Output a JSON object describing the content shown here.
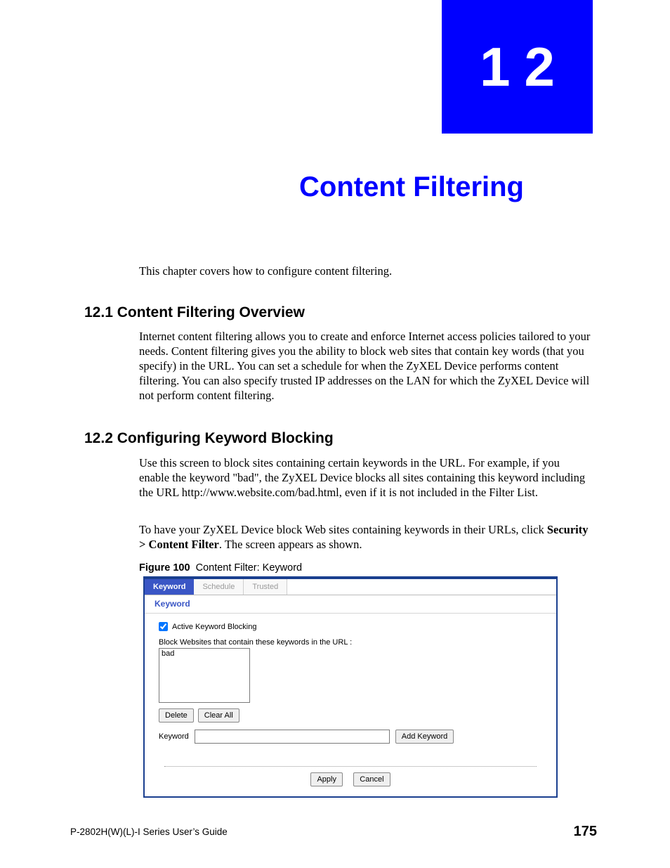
{
  "chapter": {
    "number": "12",
    "title": "Content Filtering",
    "intro": "This chapter covers how to configure content filtering."
  },
  "section1": {
    "heading": "12.1  Content Filtering Overview",
    "body": "Internet content filtering allows you to create and enforce Internet access policies tailored to your needs. Content filtering gives you the ability to block web sites that contain key words (that you specify) in the URL. You can set a schedule for when the ZyXEL Device performs content filtering. You can also specify trusted IP addresses on the LAN for which the ZyXEL Device will not perform content filtering."
  },
  "section2": {
    "heading": "12.2  Configuring Keyword Blocking",
    "body1": "Use this screen to block sites containing certain keywords in the URL. For example, if you enable the keyword \"bad\", the ZyXEL Device blocks all sites containing this keyword including the URL http://www.website.com/bad.html, even if it is not included in the Filter List.",
    "body2_prefix": "To have your ZyXEL Device block Web sites containing keywords in their URLs, click ",
    "body2_bold": "Security > Content Filter",
    "body2_suffix": ". The screen appears as shown."
  },
  "figure": {
    "label": "Figure 100",
    "caption": "Content Filter: Keyword"
  },
  "ui": {
    "tabs": {
      "keyword": "Keyword",
      "schedule": "Schedule",
      "trusted": "Trusted"
    },
    "panel_title": "Keyword",
    "active_label": "Active Keyword Blocking",
    "block_desc": "Block Websites that contain these keywords in the URL :",
    "list_item": "bad",
    "delete": "Delete",
    "clear_all": "Clear All",
    "keyword_label": "Keyword",
    "keyword_value": "",
    "add_keyword": "Add Keyword",
    "apply": "Apply",
    "cancel": "Cancel"
  },
  "footer": {
    "guide": "P-2802H(W)(L)-I Series User’s Guide",
    "page": "175"
  }
}
